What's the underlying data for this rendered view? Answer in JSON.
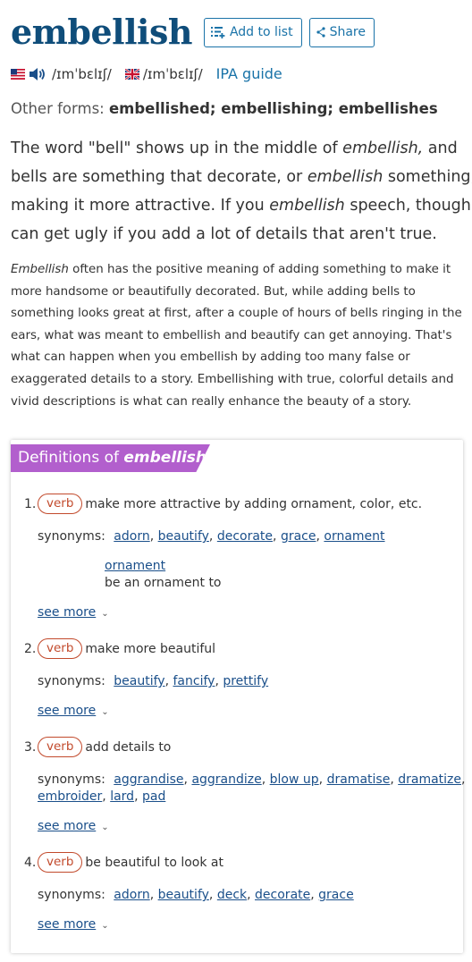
{
  "entry": {
    "headword": "embellish",
    "add_to_list_label": "Add to list",
    "share_label": "Share",
    "accent_color": "#1a73a8",
    "headword_color": "#0f4d7a"
  },
  "pronunciation": {
    "us_ipa": "/ɪmˈbɛlɪʃ/",
    "uk_ipa": "/ɪmˈbɛlɪʃ/",
    "ipa_guide_label": "IPA guide"
  },
  "other_forms": {
    "label": "Other forms:",
    "value": "embellished; embellishing; embellishes"
  },
  "short_blurb": [
    {
      "a": "The word \"bell\" shows up in the middle of ",
      "i": "embellish,",
      "b": " and"
    },
    {
      "a": "bells are something that decorate, or ",
      "i": "embellish",
      "b": " something,"
    },
    {
      "a": "making it more attractive. If you ",
      "i": "embellish",
      "b": " speech, though, it"
    },
    {
      "a": "can get ugly if you add a lot of details that aren't true.",
      "i": "",
      "b": ""
    }
  ],
  "long_blurb": [
    {
      "i": "Embellish",
      "a": " often has the positive meaning of adding something to make it"
    },
    {
      "i": "",
      "a": "more handsome or beautifully decorated. But, while adding bells to"
    },
    {
      "i": "",
      "a": "something looks great at first, after a couple of hours of bells ringing in the"
    },
    {
      "i": "",
      "a": "ears, what was meant to embellish and beautify can get annoying. That's"
    },
    {
      "i": "",
      "a": "what can happen when you embellish by adding too many false or"
    },
    {
      "i": "",
      "a": "exaggerated details to a story. Embellishing with true, colorful details and"
    },
    {
      "i": "",
      "a": "vivid descriptions is what can really enhance the beauty of a story."
    }
  ],
  "definitions": {
    "header_prefix": "Definitions of ",
    "header_word": "embellish",
    "header_color": "#b25fcd",
    "synonyms_label": "synonyms:",
    "see_more_label": "see more",
    "senses": [
      {
        "num": "1.",
        "pos": "verb",
        "definition": "make more attractive by adding ornament, color, etc.",
        "synonyms": [
          "adorn",
          "beautify",
          "decorate",
          "grace",
          "ornament"
        ],
        "extra_word": "ornament",
        "extra_gloss": "be an ornament to"
      },
      {
        "num": "2.",
        "pos": "verb",
        "definition": "make more beautiful",
        "synonyms": [
          "beautify",
          "fancify",
          "prettify"
        ]
      },
      {
        "num": "3.",
        "pos": "verb",
        "definition": "add details to",
        "synonyms_line1": [
          "aggrandise",
          "aggrandize",
          "blow up",
          "dramatise",
          "dramatize"
        ],
        "synonyms_line2": [
          "embroider",
          "lard",
          "pad"
        ]
      },
      {
        "num": "4.",
        "pos": "verb",
        "definition": "be beautiful to look at",
        "synonyms": [
          "adorn",
          "beautify",
          "deck",
          "decorate",
          "grace"
        ]
      }
    ]
  }
}
